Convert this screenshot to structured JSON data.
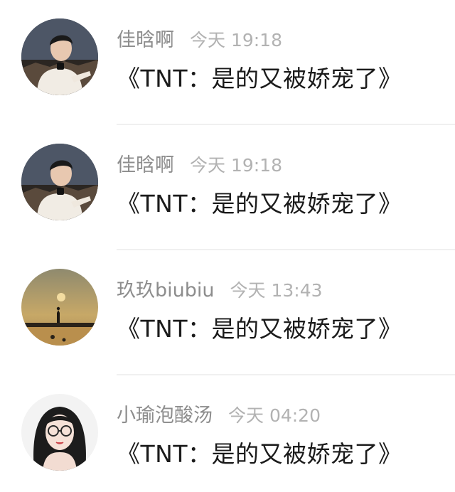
{
  "comments": [
    {
      "username": "佳晗啊",
      "time": "今天 19:18",
      "content": "《TNT：是的又被娇宠了》",
      "avatar": "boy-white-sweater-avatar"
    },
    {
      "username": "佳晗啊",
      "time": "今天 19:18",
      "content": "《TNT：是的又被娇宠了》",
      "avatar": "boy-white-sweater-avatar"
    },
    {
      "username": "玖玖biubiu",
      "time": "今天 13:43",
      "content": "《TNT：是的又被娇宠了》",
      "avatar": "sunset-silhouette-avatar"
    },
    {
      "username": "小瑜泡酸汤",
      "time": "今天 04:20",
      "content": "《TNT：是的又被娇宠了》",
      "avatar": "girl-glasses-avatar"
    }
  ],
  "colors": {
    "username": "#8d8d8d",
    "time": "#b2b2b2",
    "content": "#1b1b1b",
    "divider": "#f0f0f0"
  }
}
